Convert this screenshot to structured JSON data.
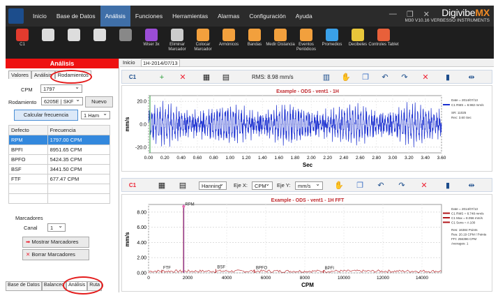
{
  "menu": [
    "Inicio",
    "Base de Datos",
    "Análisis",
    "Funciones",
    "Herramientas",
    "Alarmas",
    "Configuración",
    "Ayuda"
  ],
  "active_menu": "Análisis",
  "brand": {
    "name_a": "Digivibe",
    "name_b": "MX",
    "version": "M30 V10.16",
    "company": "VERBESSO INSTRUMENTS"
  },
  "ribbon": [
    {
      "label": "C1",
      "icon": "channel-icon",
      "color": "#e23b2e"
    },
    {
      "label": "",
      "icon": "record-icon",
      "color": "#dddddd"
    },
    {
      "label": "",
      "icon": "search-icon",
      "color": "#dddddd"
    },
    {
      "label": "",
      "icon": "refresh-icon",
      "color": "#dddddd"
    },
    {
      "label": "",
      "icon": "stop-icon",
      "color": "#888888"
    },
    {
      "label": "Wiser 3x",
      "icon": "wiser-icon",
      "color": "#9b4dd6"
    },
    {
      "label": "Eliminar Marcador",
      "icon": "trash-icon",
      "color": "#cccccc"
    },
    {
      "label": "Colocar Marcador",
      "icon": "marker-icon",
      "color": "#f2a03d"
    },
    {
      "label": "Armónicos",
      "icon": "harmonics-icon",
      "color": "#f2a03d"
    },
    {
      "label": "Bandas",
      "icon": "bands-icon",
      "color": "#f2a03d"
    },
    {
      "label": "Medir Distancia",
      "icon": "measure-icon",
      "color": "#f2a03d"
    },
    {
      "label": "Eventos Periódicos",
      "icon": "periodic-icon",
      "color": "#f2a03d"
    },
    {
      "label": "Promedios",
      "icon": "averages-icon",
      "color": "#3aa0e8"
    },
    {
      "label": "Decibeles",
      "icon": "decibels-icon",
      "color": "#e8c63a"
    },
    {
      "label": "Controles Tablet",
      "icon": "tablet-icon",
      "color": "#e8603a"
    }
  ],
  "left": {
    "header": "Análisis",
    "tabs": [
      "Valores",
      "Análisis",
      "Rodamientos"
    ],
    "cpm_label": "CPM",
    "cpm_value": "1797",
    "bearing_label": "Rodamiento",
    "bearing_value": "6205E | SKF",
    "new_button": "Nuevo",
    "calc_button": "Calcular frecuencia",
    "harmonic_value": "1 Ham",
    "table_headers": [
      "Defecto",
      "Frecuencia"
    ],
    "rows": [
      [
        "RPM",
        "1797.00 CPM"
      ],
      [
        "BPFI",
        "8951.65 CPM"
      ],
      [
        "BPFO",
        "5424.35 CPM"
      ],
      [
        "BSF",
        "3441.50 CPM"
      ],
      [
        "FTF",
        "677.47 CPM"
      ]
    ],
    "markers_title": "Marcadores",
    "channel_label": "Canal",
    "channel_value": "1",
    "show_markers": "Mostrar Marcadores",
    "delete_markers": "Borrar Marcadores",
    "bottom_tabs": [
      "Base de Datos",
      "Balanceo",
      "Análisis",
      "Ruta"
    ]
  },
  "doc_tabs": [
    "Inicio",
    "1H-2014/07/13"
  ],
  "top_toolbar": {
    "channel": "C1",
    "rms_text": "RMS: 8.98 mm/s"
  },
  "bottom_toolbar": {
    "channel": "C1",
    "window": "Hanning",
    "x_label": "Eje X:",
    "x_value": "CPM",
    "y_label": "Eje Y:",
    "y_value": "mm/s"
  },
  "chart_data": [
    {
      "type": "line",
      "title": "Example - ODS - vent1 - 1H",
      "xlabel": "Sec",
      "ylabel": "mm/s",
      "xlim": [
        0,
        3.6
      ],
      "ylim": [
        -25,
        25
      ],
      "x_ticks": [
        "0.00",
        "0.20",
        "0.40",
        "0.60",
        "0.80",
        "1.00",
        "1.20",
        "1.40",
        "1.60",
        "1.80",
        "2.00",
        "2.20",
        "2.40",
        "2.60",
        "2.80",
        "3.00",
        "3.20",
        "3.40",
        "3.60"
      ],
      "y_ticks": [
        "20.0",
        "0.0",
        "-20.0"
      ],
      "legend": [
        "Date = 2014/07/13",
        "C1 RMS = 8.982 mm/s",
        "SR: 11025",
        "Rec: 3.60 Sec"
      ],
      "color": "#1a2fd0"
    },
    {
      "type": "line",
      "title": "Example - ODS - vent1 - 1H FFT",
      "xlabel": "CPM",
      "ylabel": "mm/s",
      "xlim": [
        0,
        15000
      ],
      "ylim": [
        0,
        9
      ],
      "x_ticks": [
        "0",
        "2000",
        "4000",
        "6000",
        "8000",
        "10000",
        "12000",
        "14000"
      ],
      "y_ticks": [
        "8.00",
        "6.00",
        "4.00",
        "2.00",
        "0.00"
      ],
      "peaks": [
        {
          "x": 677,
          "y": 0.4,
          "label": "FTF"
        },
        {
          "x": 1797,
          "y": 8.75,
          "label": "RPM"
        },
        {
          "x": 3441,
          "y": 0.5,
          "label": "BSF"
        },
        {
          "x": 5424,
          "y": 0.4,
          "label": "BPFO"
        },
        {
          "x": 8951,
          "y": 0.35,
          "label": "BPFI"
        }
      ],
      "legend": [
        "Date = 2014/07/13",
        "C1 RMS = 8.748 mm/s",
        "C1 Max = 8.056 mm/s",
        "C1 Sens = A 100",
        "Res: 16384 Points",
        "Res: 20.19 CPM / Points",
        "FFt: 256396 CPM",
        "Averages: 1"
      ],
      "color": "#b0151a"
    }
  ]
}
